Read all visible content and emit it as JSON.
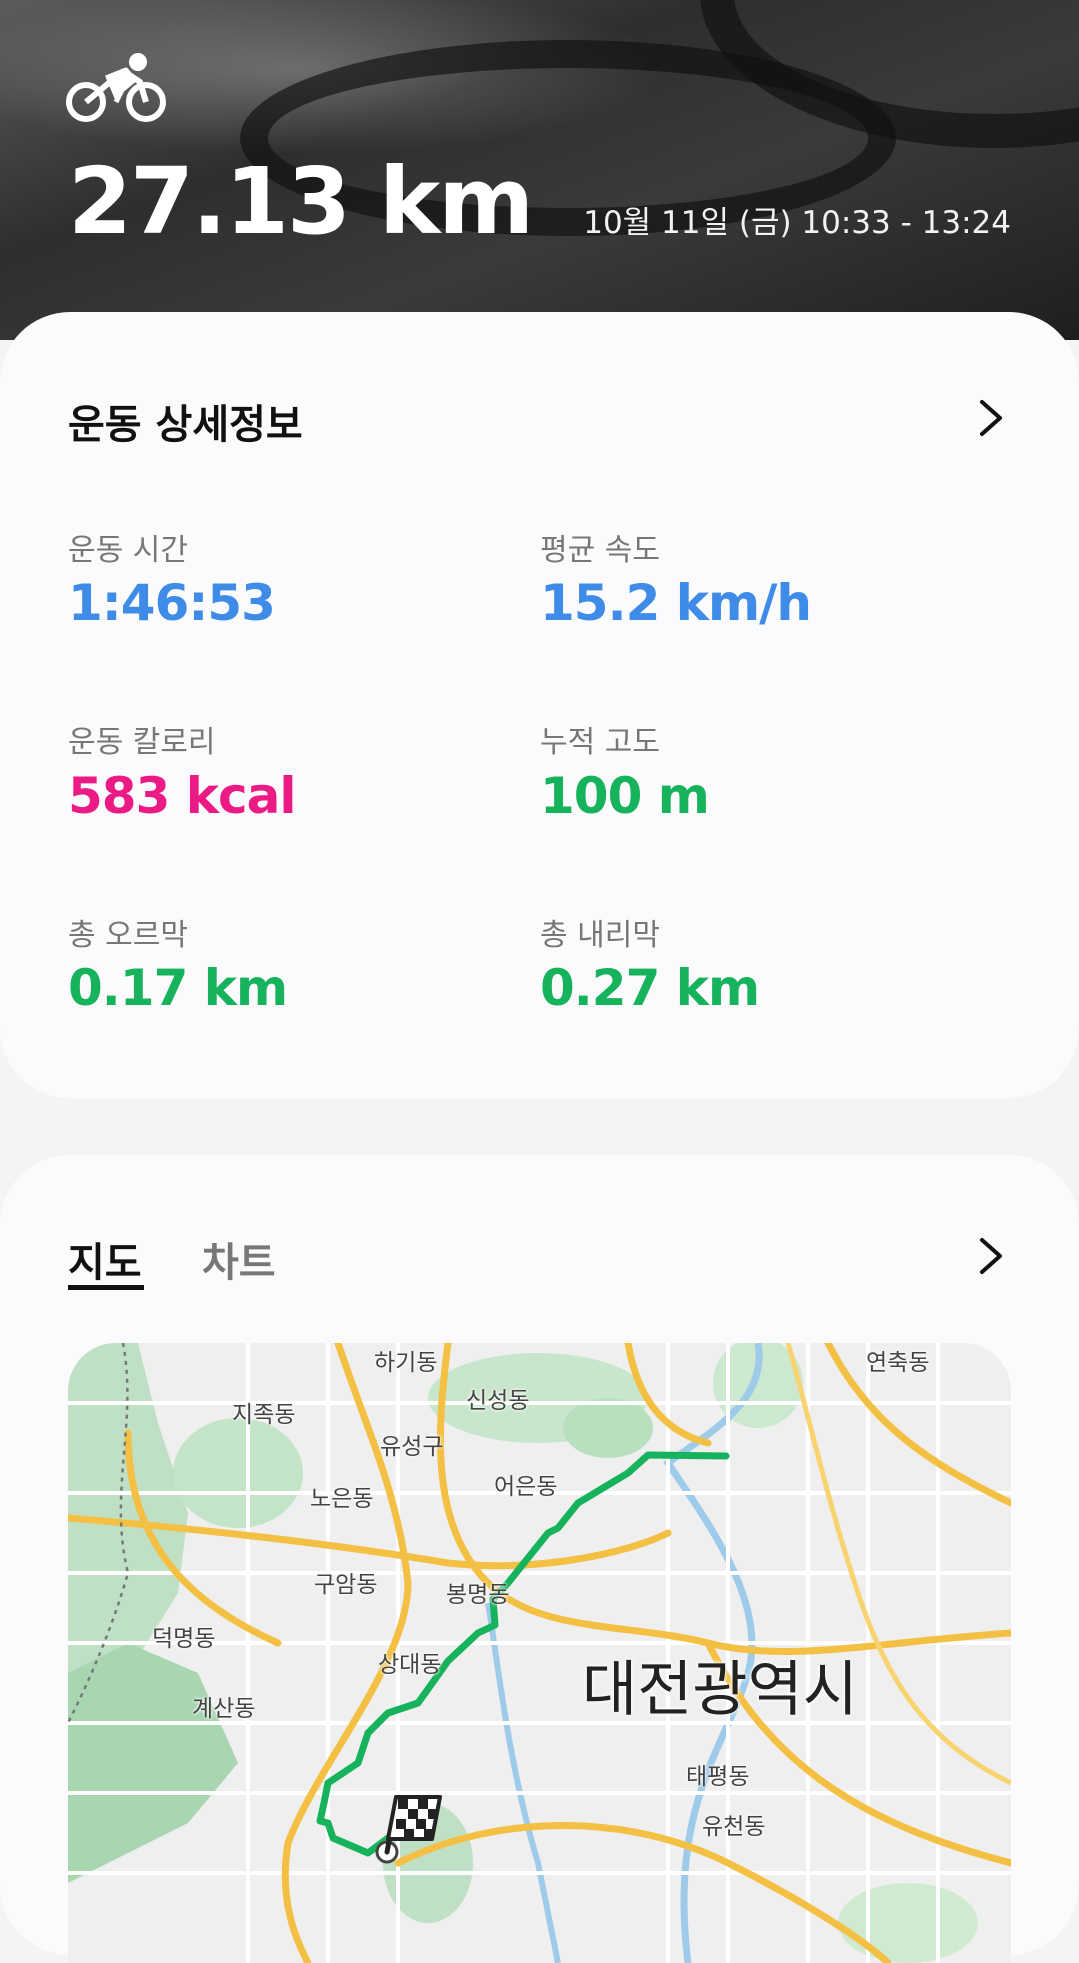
{
  "header": {
    "activity_icon": "bicycle-icon",
    "distance": "27.13 km",
    "datetime": "10월 11일 (금) 10:33 - 13:24"
  },
  "details": {
    "title": "운동 상세정보",
    "metrics": [
      {
        "label": "운동 시간",
        "value": "1:46:53",
        "color": "#3f8ce8"
      },
      {
        "label": "평균 속도",
        "value": "15.2 km/h",
        "color": "#3f8ce8"
      },
      {
        "label": "운동 칼로리",
        "value": "583 kcal",
        "color": "#ec1a84"
      },
      {
        "label": "누적 고도",
        "value": "100 m",
        "color": "#17b35c"
      },
      {
        "label": "총 오르막",
        "value": "0.17 km",
        "color": "#17b35c"
      },
      {
        "label": "총 내리막",
        "value": "0.27 km",
        "color": "#17b35c"
      }
    ]
  },
  "map_section": {
    "tabs": [
      {
        "label": "지도",
        "active": true
      },
      {
        "label": "차트",
        "active": false
      }
    ],
    "route_color": "#17b35c",
    "end_marker_icon": "checkered-flag-icon",
    "places": [
      "하기동",
      "연축동",
      "신성동",
      "지족동",
      "유성구",
      "어은동",
      "노은동",
      "구암동",
      "봉명동",
      "덕명동",
      "상대동",
      "계산동",
      "태평동",
      "유천동"
    ],
    "city": "대전광역시"
  }
}
